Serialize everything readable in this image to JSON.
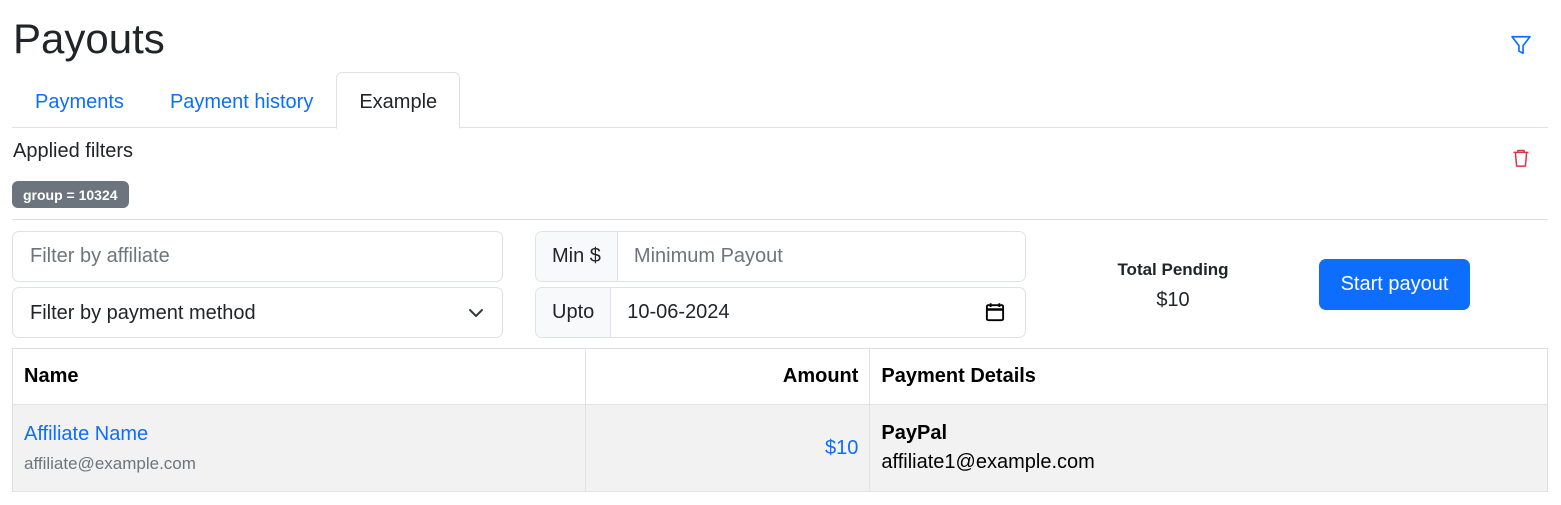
{
  "header": {
    "title": "Payouts"
  },
  "tabs": [
    {
      "label": "Payments"
    },
    {
      "label": "Payment history"
    },
    {
      "label": "Example"
    }
  ],
  "filters": {
    "applied_title": "Applied filters",
    "badge": "group = 10324",
    "affiliate_placeholder": "Filter by affiliate",
    "payment_method_value": "Filter by payment method",
    "min_addon": "Min $",
    "min_placeholder": "Minimum Payout",
    "upto_addon": "Upto",
    "upto_value": "10-06-2024"
  },
  "summary": {
    "pending_label": "Total Pending",
    "pending_value": "$10",
    "start_payout_label": "Start payout"
  },
  "table": {
    "columns": [
      "Name",
      "Amount",
      "Payment Details"
    ],
    "rows": [
      {
        "name": "Affiliate Name",
        "email": "affiliate@example.com",
        "amount": "$10",
        "method": "PayPal",
        "method_detail": "affiliate1@example.com"
      }
    ]
  },
  "icons": {
    "filter": "filter-icon",
    "trash": "trash-icon",
    "chevron": "chevron-down-icon",
    "calendar": "calendar-icon"
  },
  "colors": {
    "accent": "#0d6efd",
    "danger": "#dc3545",
    "badge": "#6c757d"
  }
}
